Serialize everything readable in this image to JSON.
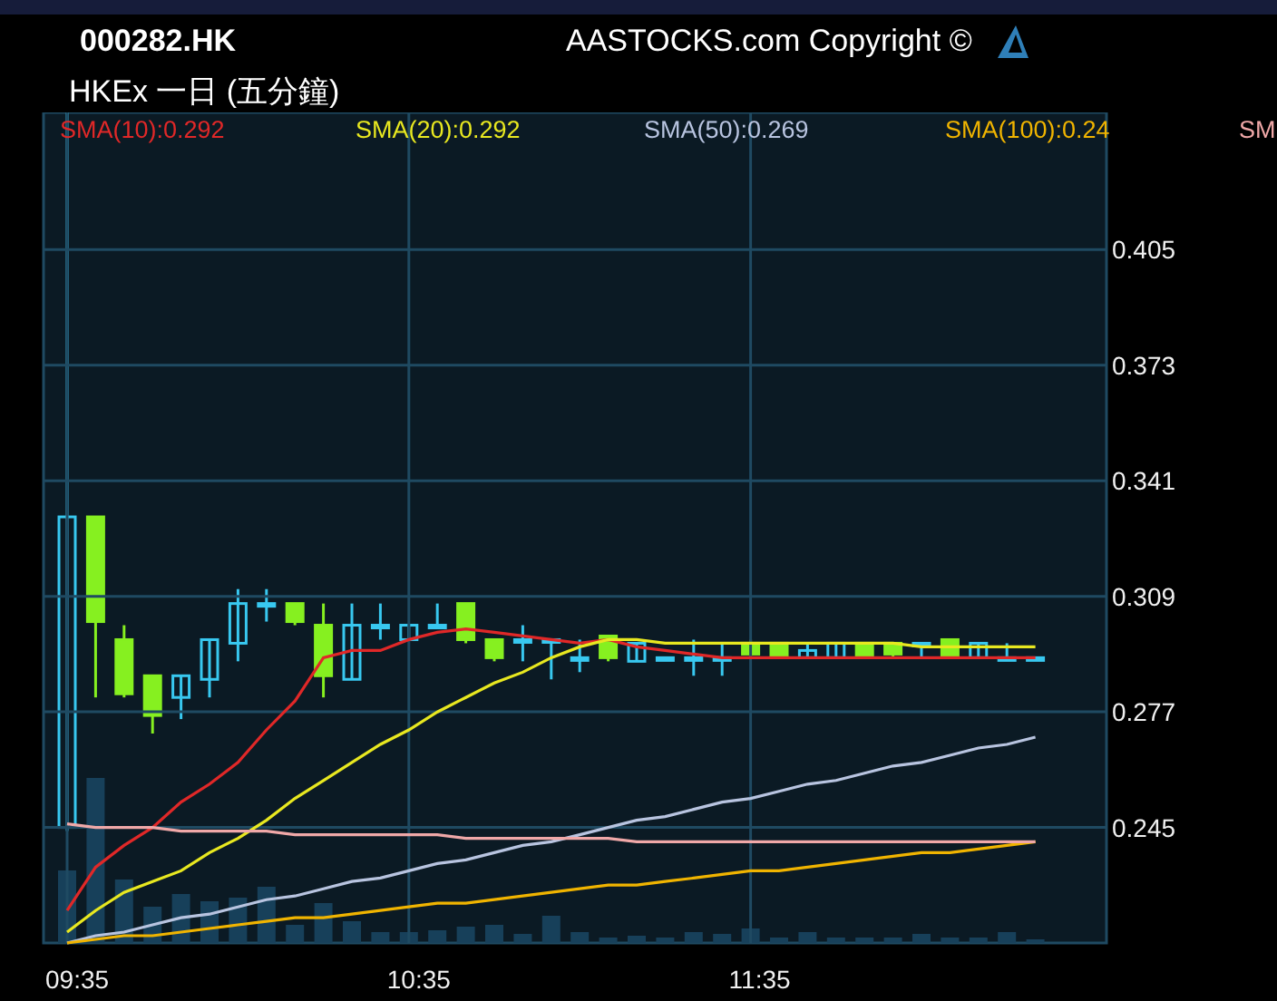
{
  "header": {
    "symbol": "000282.HK",
    "copyright": "AASTOCKS.com Copyright ©",
    "subtitle": "HKEx 一日 (五分鐘)"
  },
  "chart_data": {
    "type": "line",
    "categories": [
      "09:35",
      null,
      null,
      null,
      null,
      null,
      null,
      null,
      null,
      null,
      null,
      null,
      "10:35",
      null,
      null,
      null,
      null,
      null,
      null,
      null,
      null,
      null,
      null,
      null,
      "11:35",
      null,
      null,
      null,
      null,
      null,
      null,
      null,
      null,
      null,
      null
    ],
    "ylim": [
      0.213,
      0.443
    ],
    "grid": true,
    "yticks": [
      0.405,
      0.373,
      0.341,
      0.309,
      0.277,
      0.245
    ],
    "series": [
      {
        "name": "SMA(10):0.292",
        "color": "#e02828",
        "values": [
          0.222,
          0.234,
          0.24,
          0.245,
          0.252,
          0.257,
          0.263,
          0.272,
          0.28,
          0.292,
          0.294,
          0.294,
          0.297,
          0.299,
          0.3,
          0.299,
          0.298,
          0.297,
          0.296,
          0.297,
          0.295,
          0.294,
          0.293,
          0.292,
          0.292,
          0.292,
          0.292,
          0.292,
          0.292,
          0.292,
          0.292,
          0.292,
          0.292,
          0.292,
          0.292
        ]
      },
      {
        "name": "SMA(20):0.292",
        "color": "#e8e820",
        "values": [
          0.216,
          0.222,
          0.227,
          0.23,
          0.233,
          0.238,
          0.242,
          0.247,
          0.253,
          0.258,
          0.263,
          0.268,
          0.272,
          0.277,
          0.281,
          0.285,
          0.288,
          0.292,
          0.295,
          0.297,
          0.297,
          0.296,
          0.296,
          0.296,
          0.296,
          0.296,
          0.296,
          0.296,
          0.296,
          0.296,
          0.295,
          0.295,
          0.295,
          0.295,
          0.295
        ]
      },
      {
        "name": "SMA(50):0.269",
        "color": "#b8c4e0",
        "values": [
          0.213,
          0.215,
          0.216,
          0.218,
          0.22,
          0.221,
          0.223,
          0.225,
          0.226,
          0.228,
          0.23,
          0.231,
          0.233,
          0.235,
          0.236,
          0.238,
          0.24,
          0.241,
          0.243,
          0.245,
          0.247,
          0.248,
          0.25,
          0.252,
          0.253,
          0.255,
          0.257,
          0.258,
          0.26,
          0.262,
          0.263,
          0.265,
          0.267,
          0.268,
          0.27
        ]
      },
      {
        "name": "SMA(100):0.24",
        "color": "#f0b400",
        "values": [
          0.213,
          0.214,
          0.215,
          0.215,
          0.216,
          0.217,
          0.218,
          0.219,
          0.22,
          0.22,
          0.221,
          0.222,
          0.223,
          0.224,
          0.224,
          0.225,
          0.226,
          0.227,
          0.228,
          0.229,
          0.229,
          0.23,
          0.231,
          0.232,
          0.233,
          0.233,
          0.234,
          0.235,
          0.236,
          0.237,
          0.238,
          0.238,
          0.239,
          0.24,
          0.241
        ]
      },
      {
        "name": "SM",
        "color": "#f0a8a8",
        "values": [
          0.246,
          0.245,
          0.245,
          0.245,
          0.244,
          0.244,
          0.244,
          0.244,
          0.243,
          0.243,
          0.243,
          0.243,
          0.243,
          0.243,
          0.242,
          0.242,
          0.242,
          0.242,
          0.242,
          0.242,
          0.241,
          0.241,
          0.241,
          0.241,
          0.241,
          0.241,
          0.241,
          0.241,
          0.241,
          0.241,
          0.241,
          0.241,
          0.241,
          0.241,
          0.241
        ]
      }
    ]
  }
}
